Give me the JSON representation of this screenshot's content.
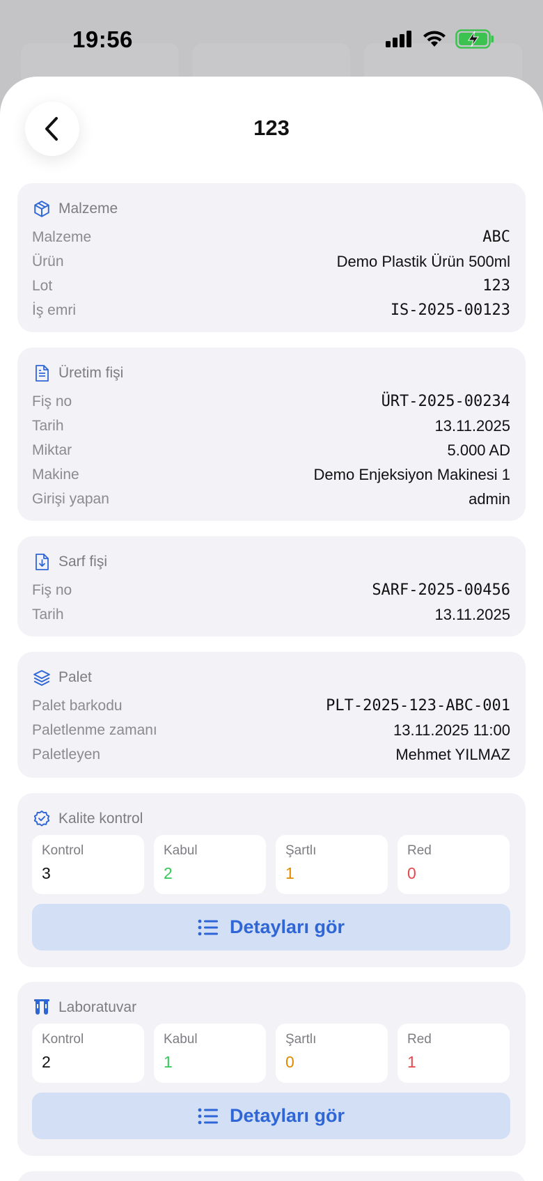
{
  "status": {
    "time": "19:56"
  },
  "sheet": {
    "title": "123"
  },
  "colors": {
    "accent": "#2f66d6",
    "accept": "#34c759",
    "conditional": "#e08a00",
    "reject": "#e5484d"
  },
  "material": {
    "header": "Malzeme",
    "rows": [
      {
        "k": "Malzeme",
        "v": "ABC"
      },
      {
        "k": "Ürün",
        "v": "Demo Plastik Ürün 500ml"
      },
      {
        "k": "Lot",
        "v": "123"
      },
      {
        "k": "İş emri",
        "v": "IS-2025-00123"
      }
    ]
  },
  "production": {
    "header": "Üretim fişi",
    "rows": [
      {
        "k": "Fiş no",
        "v": "ÜRT-2025-00234"
      },
      {
        "k": "Tarih",
        "v": "13.11.2025"
      },
      {
        "k": "Miktar",
        "v": "5.000 AD"
      },
      {
        "k": "Makine",
        "v": "Demo Enjeksiyon Makinesi 1"
      },
      {
        "k": "Girişi yapan",
        "v": "admin"
      }
    ]
  },
  "consumption": {
    "header": "Sarf fişi",
    "rows": [
      {
        "k": "Fiş no",
        "v": "SARF-2025-00456"
      },
      {
        "k": "Tarih",
        "v": "13.11.2025"
      }
    ]
  },
  "pallet": {
    "header": "Palet",
    "rows": [
      {
        "k": "Palet barkodu",
        "v": "PLT-2025-123-ABC-001"
      },
      {
        "k": "Paletlenme zamanı",
        "v": "13.11.2025 11:00"
      },
      {
        "k": "Paletleyen",
        "v": "Mehmet YILMAZ"
      }
    ]
  },
  "quality": {
    "header": "Kalite kontrol",
    "stats": [
      {
        "label": "Kontrol",
        "value": "3"
      },
      {
        "label": "Kabul",
        "value": "2"
      },
      {
        "label": "Şartlı",
        "value": "1"
      },
      {
        "label": "Red",
        "value": "0"
      }
    ],
    "button": "Detayları gör"
  },
  "lab": {
    "header": "Laboratuvar",
    "stats": [
      {
        "label": "Kontrol",
        "value": "2"
      },
      {
        "label": "Kabul",
        "value": "1"
      },
      {
        "label": "Şartlı",
        "value": "0"
      },
      {
        "label": "Red",
        "value": "1"
      }
    ],
    "button": "Detayları gör"
  }
}
